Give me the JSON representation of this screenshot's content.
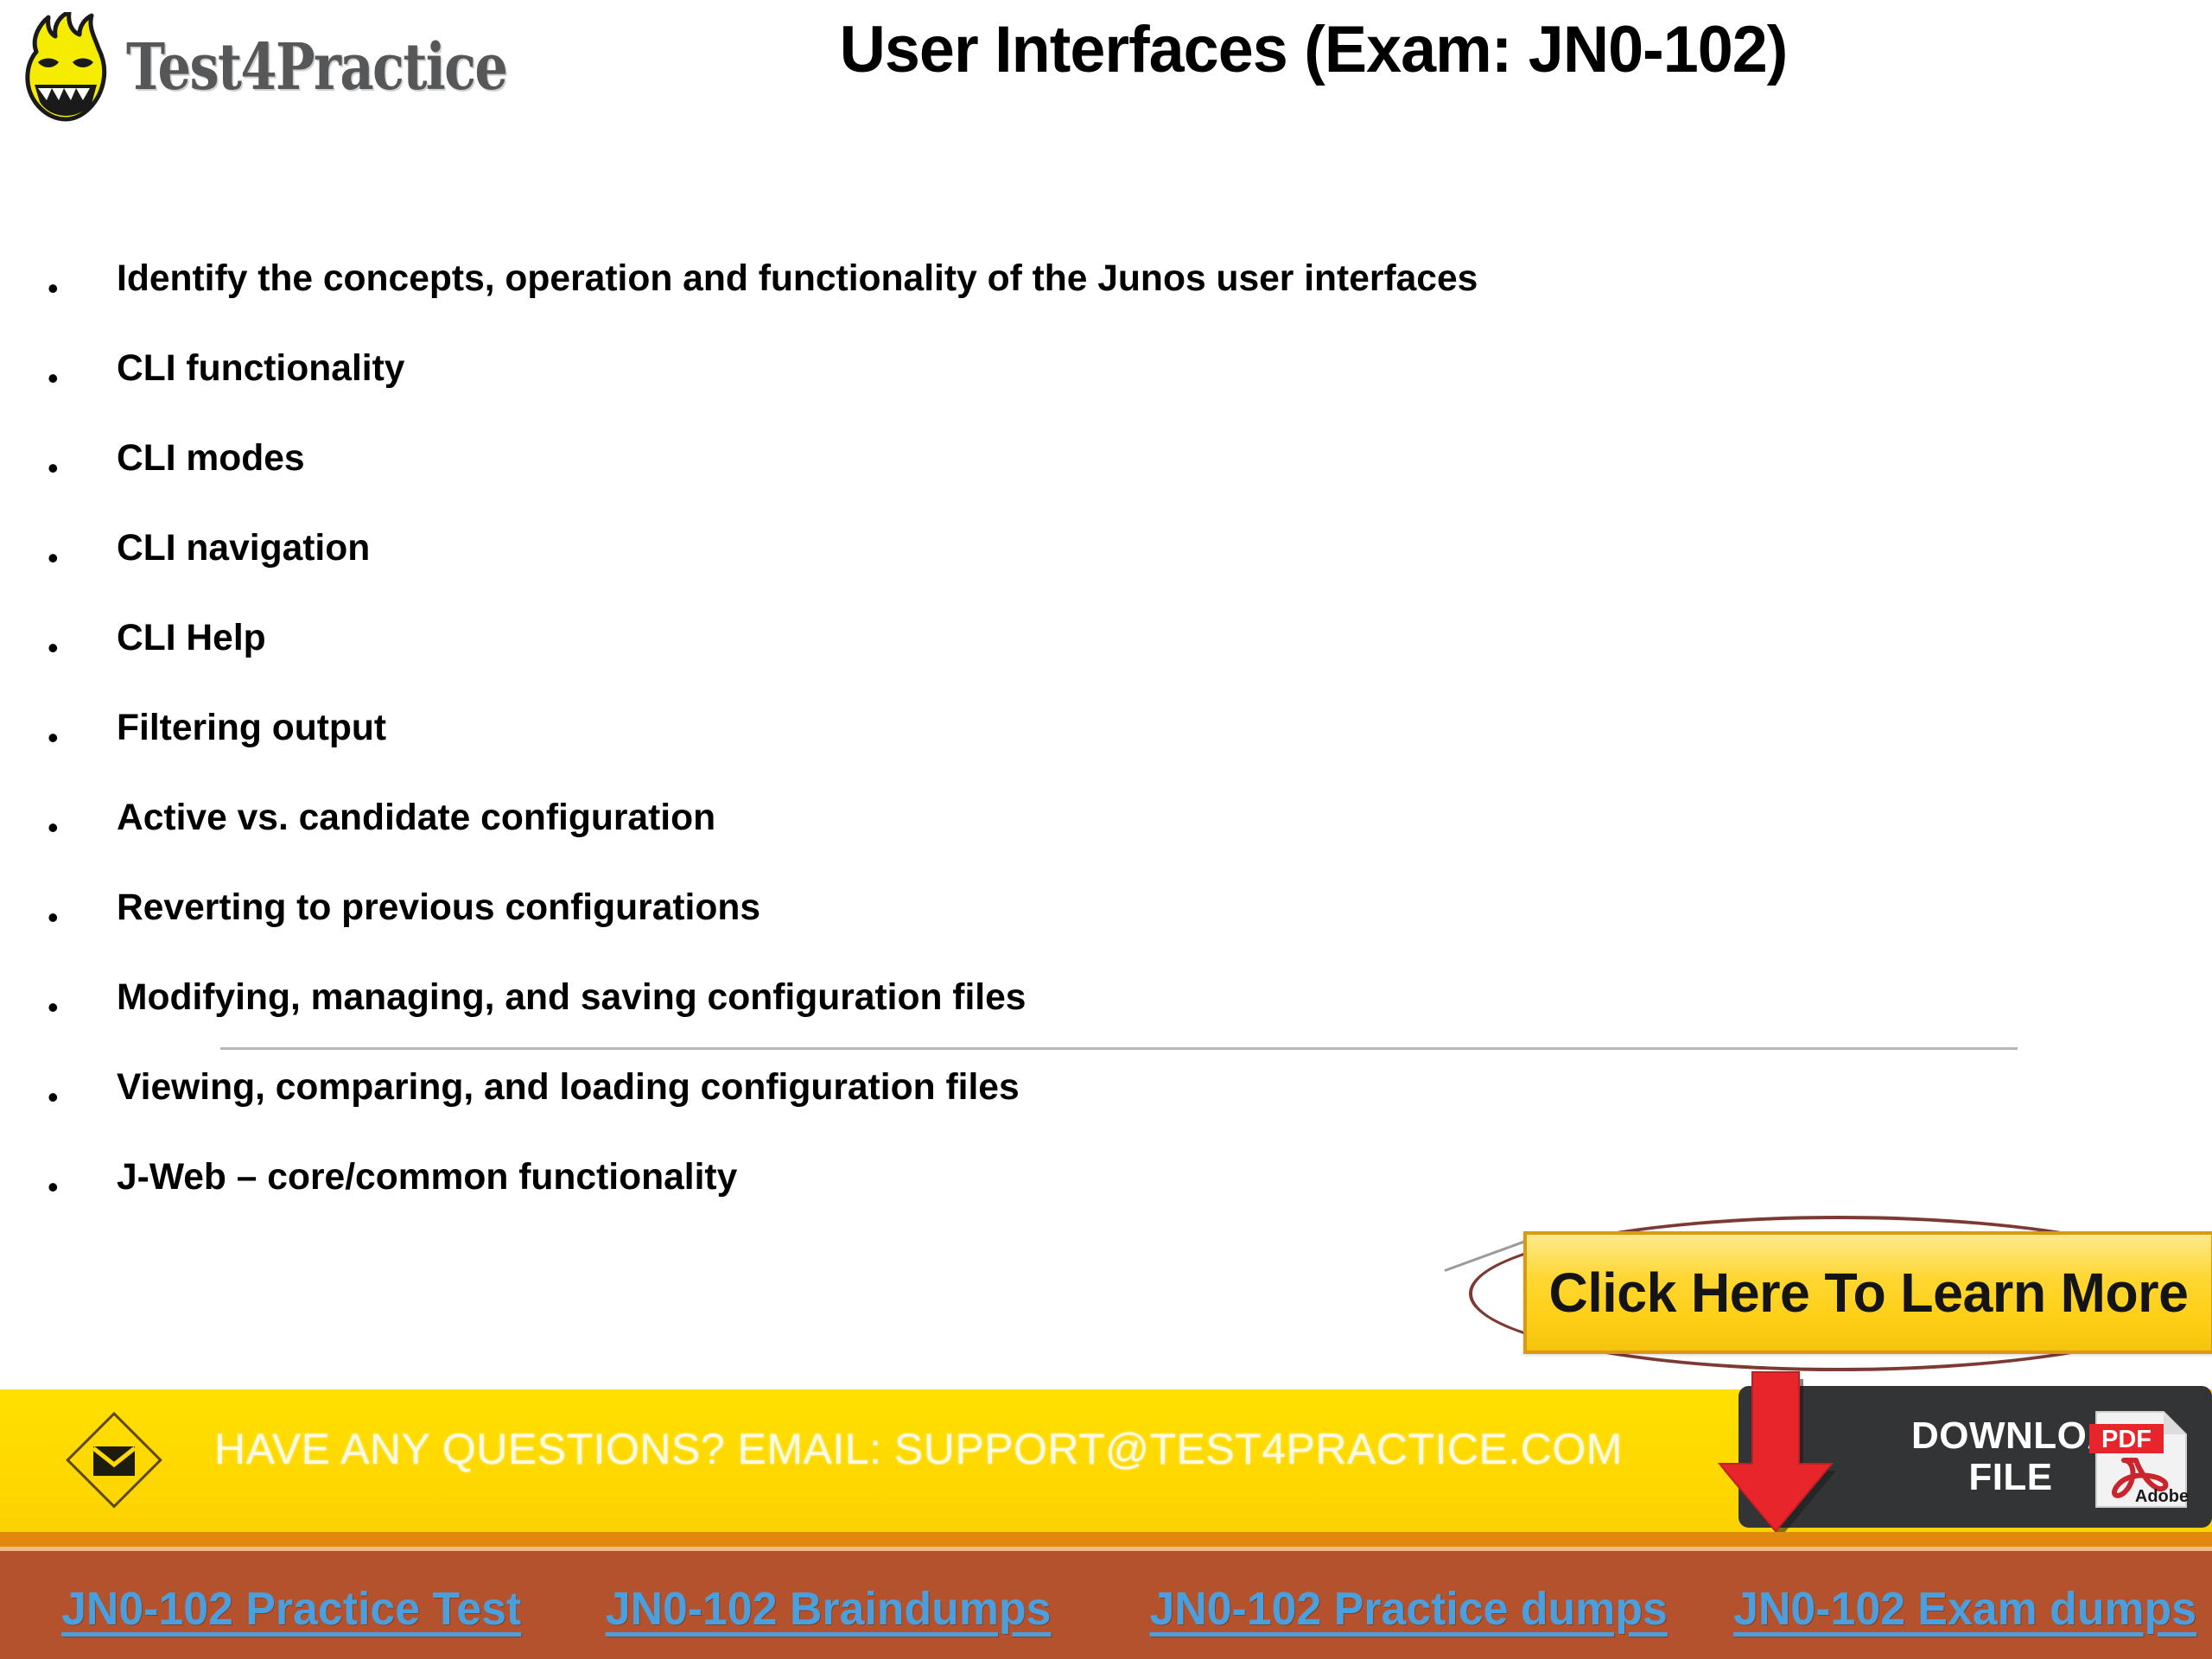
{
  "brand": {
    "logo_icon": "flame-head-mascot-icon",
    "name": "Test4Practice"
  },
  "header": {
    "title": "User Interfaces (Exam: JN0-102)"
  },
  "body": {
    "bullet_char": "•",
    "bullets": [
      "Identify the concepts, operation and functionality of the Junos user interfaces",
      "CLI functionality",
      "CLI modes",
      "CLI navigation",
      "CLI Help",
      "Filtering output",
      "Active vs. candidate configuration",
      "Reverting to previous configurations",
      "Modifying, managing, and saving configuration files",
      "Viewing, comparing, and loading configuration files",
      "J-Web – core/common functionality"
    ]
  },
  "cta": {
    "label": "Click Here To Learn More",
    "button_fill": "#ffd731",
    "button_border": "#d99a12",
    "ellipse_color": "#7d3a33"
  },
  "email_bar": {
    "icon": "envelope-in-diamond-icon",
    "text": "HAVE ANY QUESTIONS? EMAIL: SUPPORT@TEST4PRACTICE.COM",
    "bg": "#ffd900",
    "text_color": "#fffbe0"
  },
  "download": {
    "line1": "DOWNLOAD",
    "line2": "FILE",
    "arrow_icon": "down-arrow-icon",
    "file_icon": "adobe-pdf-icon",
    "pdf_label": "PDF",
    "adobe_label": "Adobe",
    "button_bg": "#333436",
    "arrow_color": "#e8252a"
  },
  "footer": {
    "bg": "#b4522e",
    "link_color": "#4a9fdc",
    "links": [
      "JN0-102 Practice Test",
      "JN0-102 Braindumps",
      "JN0-102 Practice dumps",
      "JN0-102 Exam dumps"
    ]
  }
}
